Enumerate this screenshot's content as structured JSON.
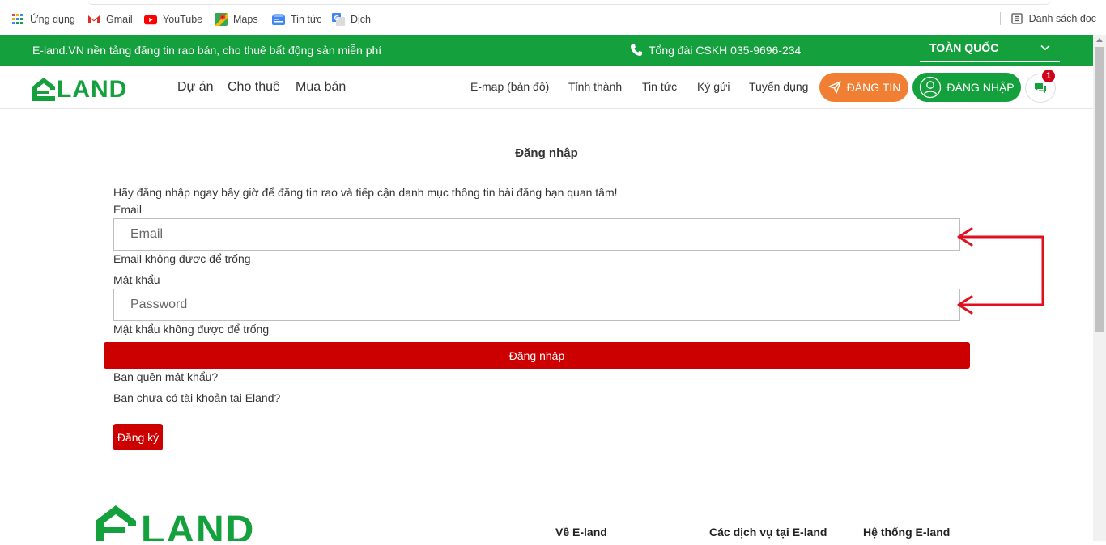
{
  "bookmarks": {
    "items": [
      {
        "label": "Ứng dụng",
        "icon": "apps-grid-icon"
      },
      {
        "label": "Gmail",
        "icon": "gmail-icon"
      },
      {
        "label": "YouTube",
        "icon": "youtube-icon"
      },
      {
        "label": "Maps",
        "icon": "maps-icon"
      },
      {
        "label": "Tin tức",
        "icon": "news-icon"
      },
      {
        "label": "Dịch",
        "icon": "translate-icon"
      }
    ],
    "reading_list": "Danh sách đọc"
  },
  "topbar": {
    "tagline": "E-land.VN nền tảng đăng tin rao bán, cho thuê bất động sản miễn phí",
    "hotline": "Tổng đài CSKH 035-9696-234",
    "region": "TOÀN QUỐC"
  },
  "nav": {
    "logo": "LAND",
    "main": [
      "Dự án",
      "Cho thuê",
      "Mua bán"
    ],
    "secondary": [
      "E-map (bản đồ)",
      "Tỉnh thành",
      "Tin tức",
      "Ký gửi",
      "Tuyển dụng"
    ],
    "post_button": "ĐĂNG TIN",
    "login_button": "ĐĂNG NHẬP",
    "chat_badge": "1"
  },
  "form": {
    "title": "Đăng nhập",
    "intro": "Hãy đăng nhập ngay bây giờ để đăng tin rao và tiếp cận danh mục thông tin bài đăng bạn quan tâm!",
    "email_label": "Email",
    "email_placeholder": "Email",
    "email_error": "Email không được để trống",
    "password_label": "Mật khẩu",
    "password_placeholder": "Password",
    "password_error": "Mật khẩu không được để trống",
    "submit": "Đăng nhập",
    "forgot": "Bạn quên mật khẩu?",
    "no_account": "Bạn chưa có tài khoản tại Eland?",
    "register": "Đăng ký"
  },
  "footer": {
    "logo": "LAND",
    "columns": [
      "Về E-land",
      "Các dịch vụ tại E-land",
      "Hệ thống E-land"
    ]
  },
  "colors": {
    "brand_green": "#14a03c",
    "accent_orange": "#f07e33",
    "action_red": "#cc0000",
    "annotation_red": "#e01020"
  }
}
